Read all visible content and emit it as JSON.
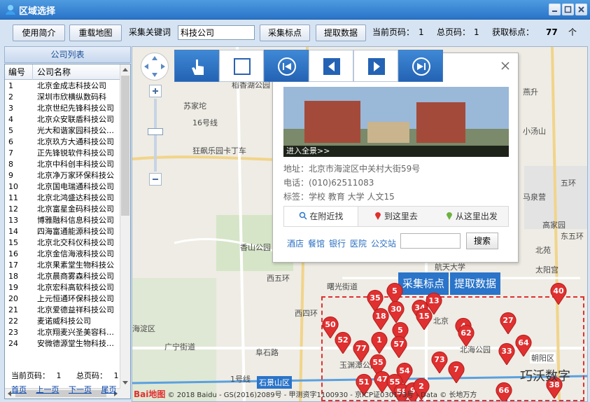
{
  "window": {
    "title": "区域选择"
  },
  "toolbar": {
    "intro_label": "使用简介",
    "reload_label": "重载地图",
    "keyword_label": "采集关键词",
    "keyword_value": "科技公司",
    "collect_label": "采集标点",
    "extract_label": "提取数据",
    "current_page_label": "当前页码：",
    "current_page_value": "1",
    "total_page_label": "总页码：",
    "total_page_value": "1",
    "points_label": "获取标点：",
    "points_value": "77",
    "points_unit": "个"
  },
  "company_list": {
    "title": "公司列表",
    "columns": [
      "编号",
      "公司名称"
    ],
    "rows": [
      [
        "1",
        "北京金成志科技公司"
      ],
      [
        "2",
        "深圳市欣横纵数码科"
      ],
      [
        "3",
        "北京世纪先锋科技公司"
      ],
      [
        "4",
        "北京众安联盾科技公司"
      ],
      [
        "5",
        "光大和谐家园科技公…"
      ],
      [
        "6",
        "北京玖方大通科技公司"
      ],
      [
        "7",
        "正先锋锐软件科技公司"
      ],
      [
        "8",
        "北京中科创丰科技公司"
      ],
      [
        "9",
        "北京净万家环保科技公"
      ],
      [
        "10",
        "北京国电瑞通科技公司"
      ],
      [
        "11",
        "北京北鸿盛达科技公司"
      ],
      [
        "12",
        "北京富星金码科技公司"
      ],
      [
        "13",
        "博雅融科信息科技公司"
      ],
      [
        "14",
        "四海富通能源科技公司"
      ],
      [
        "15",
        "北京北交科仪科技公司"
      ],
      [
        "16",
        "北京金信海液科技公司"
      ],
      [
        "17",
        "北京果素堂生物科技公"
      ],
      [
        "18",
        "北京晨商雾森科技公司"
      ],
      [
        "19",
        "北京宏科高软科技公司"
      ],
      [
        "20",
        "上元恒通环保科技公司"
      ],
      [
        "21",
        "北京爱德益祥科技公司"
      ],
      [
        "22",
        "麦诺威科技公司"
      ],
      [
        "23",
        "北京翔麦兴圣美容科…"
      ],
      [
        "24",
        "安微德源堂生物科技…"
      ]
    ],
    "pager": {
      "current_label": "当前页码：",
      "current_value": "1",
      "total_label": "总页码：",
      "total_value": "1",
      "first": "首页",
      "prev": "上一页",
      "next": "下一页",
      "last": "尾页"
    }
  },
  "map": {
    "labels": [
      "稻香湖公园",
      "苏家坨",
      "16号线",
      "狂飙乐园卡丁车",
      "香山公园",
      "西五环",
      "西四环",
      "曙光街道",
      "海淀区",
      "广宁街道",
      "阜石路",
      "石景山区",
      "北京",
      "玉渊潭公园",
      "北海公园",
      "朝阳区",
      "航天大学",
      "燕升",
      "小汤山",
      "马泉营",
      "五环",
      "高家园",
      "东五环",
      "北苑",
      "太阳宫",
      "1号线"
    ],
    "popup": {
      "pano_label": "进入全景>>",
      "address": "地址：北京市海淀区中关村大街59号",
      "phone": "电话：(010)62511083",
      "tags": "标签：学校 教育 大学 人文15",
      "tabs": [
        "在附近找",
        "到这里去",
        "从这里出发"
      ],
      "quick_links": [
        "酒店",
        "餐馆",
        "银行",
        "医院",
        "公交站"
      ],
      "search_label": "搜索"
    },
    "overlay_buttons": [
      "采集标点",
      "提取数据"
    ],
    "markers": [
      "40",
      "5",
      "35",
      "13",
      "34",
      "30",
      "18",
      "15",
      "50",
      "4",
      "27",
      "62",
      "1",
      "5",
      "52",
      "57",
      "77",
      "73",
      "7",
      "33",
      "64",
      "54",
      "55",
      "47",
      "55",
      "51",
      "58",
      "9",
      "2",
      "66",
      "38"
    ],
    "copyright": "© 2018 Baidu - GS(2016)2089号 - 甲测资字1100930 - 京ICP证030173号 - Data © 长地万方",
    "baidu_logo": "Bai地图",
    "watermark": "巧沃数字"
  },
  "colors": {
    "titlebar": "#2a74c9",
    "marker": "#e03030",
    "accent": "#2a74c9"
  }
}
